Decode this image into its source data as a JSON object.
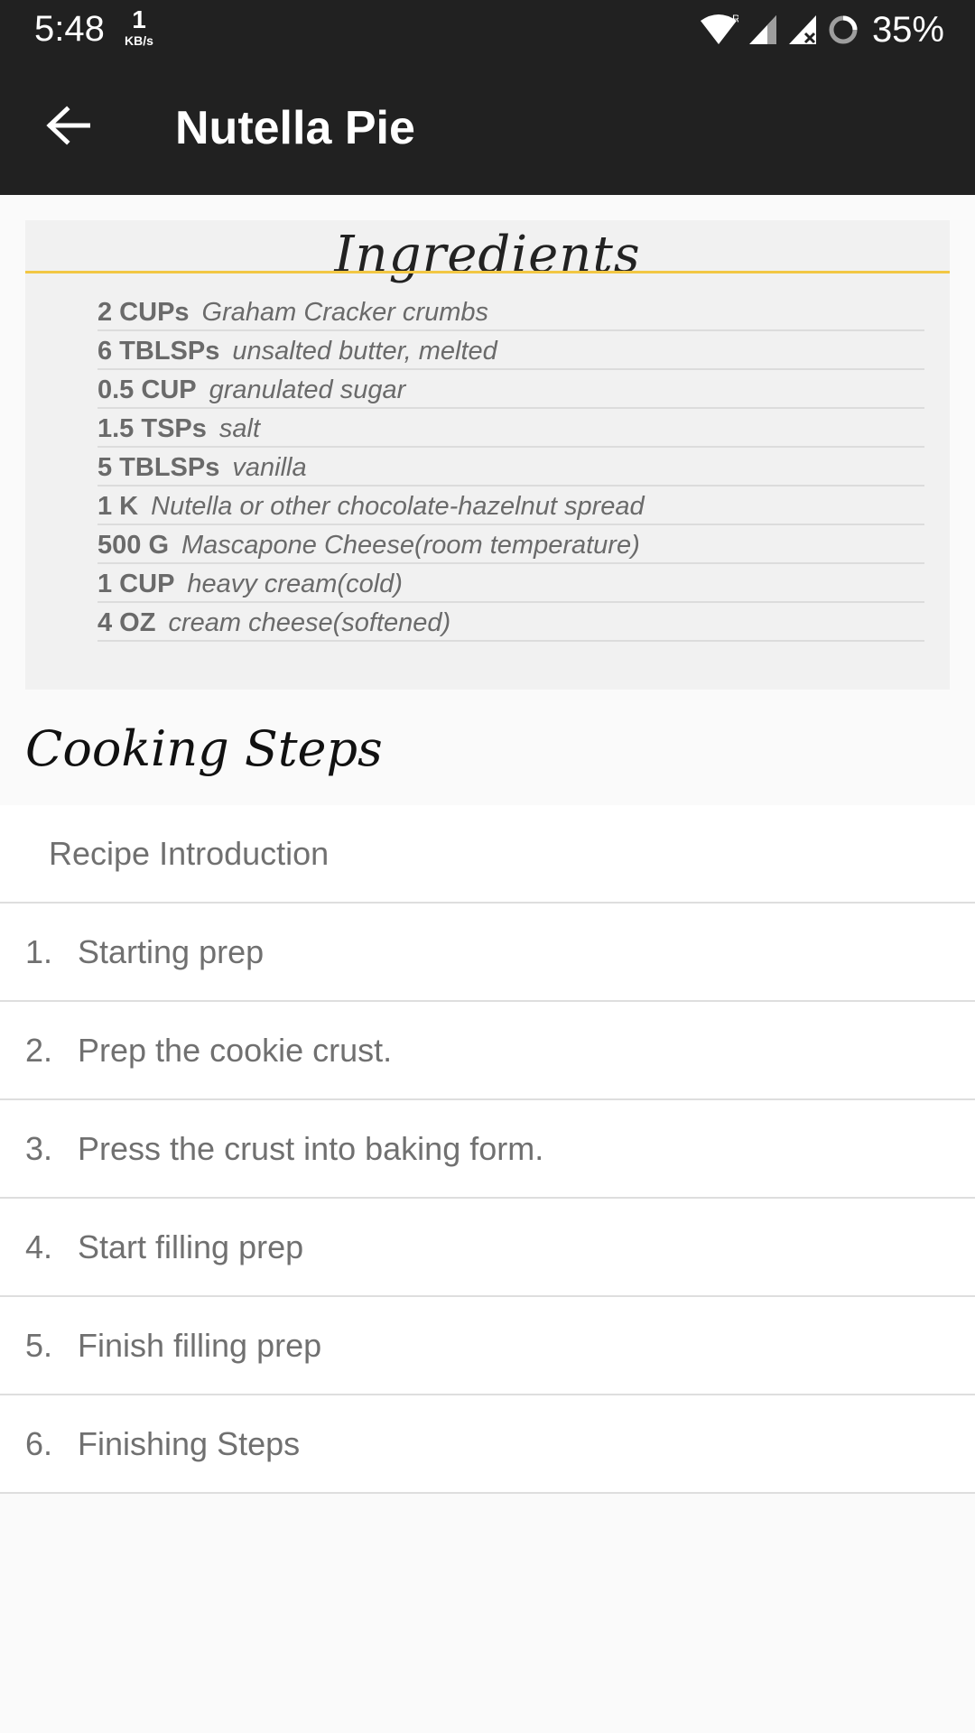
{
  "status_bar": {
    "time": "5:48",
    "net_speed_value": "1",
    "net_speed_unit": "KB/s",
    "battery": "35%",
    "icons": [
      "wifi-icon",
      "signal-icon",
      "signal-no-data-icon",
      "battery-icon"
    ]
  },
  "app_bar": {
    "back_icon": "arrow-left-icon",
    "title": "Nutella Pie"
  },
  "ingredients": {
    "title": "Ingredients",
    "items": [
      {
        "qty": "2 CUPs",
        "name": "Graham Cracker crumbs"
      },
      {
        "qty": "6 TBLSPs",
        "name": "unsalted butter, melted"
      },
      {
        "qty": "0.5 CUP",
        "name": "granulated sugar"
      },
      {
        "qty": "1.5 TSPs",
        "name": "salt"
      },
      {
        "qty": "5 TBLSPs",
        "name": "vanilla"
      },
      {
        "qty": "1 K",
        "name": "Nutella or other chocolate-hazelnut spread"
      },
      {
        "qty": "500 G",
        "name": "Mascapone Cheese(room temperature)"
      },
      {
        "qty": "1 CUP",
        "name": "heavy cream(cold)"
      },
      {
        "qty": "4 OZ",
        "name": "cream cheese(softened)"
      }
    ]
  },
  "cooking_steps": {
    "title": "Cooking Steps",
    "intro": "Recipe Introduction",
    "steps": [
      {
        "num": "1.",
        "label": "Starting prep"
      },
      {
        "num": "2.",
        "label": "Prep the cookie crust."
      },
      {
        "num": "3.",
        "label": "Press the crust into baking form."
      },
      {
        "num": "4.",
        "label": "Start filling prep"
      },
      {
        "num": "5.",
        "label": "Finish filling prep"
      },
      {
        "num": "6.",
        "label": "Finishing Steps"
      }
    ]
  },
  "colors": {
    "app_bar": "#212121",
    "accent_rule": "#f2c744",
    "card_bg": "#f1f1f1",
    "text_muted": "#707070"
  }
}
